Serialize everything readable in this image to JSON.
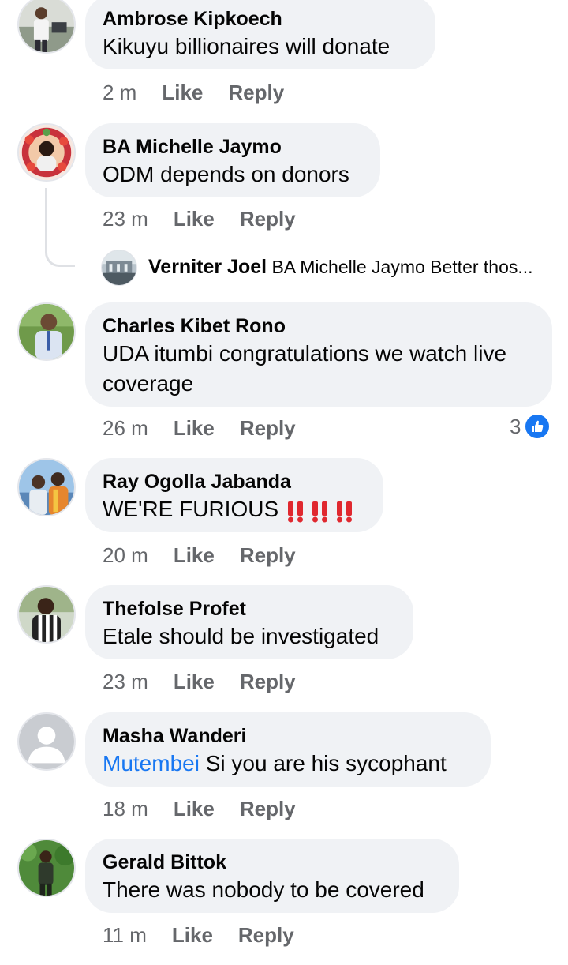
{
  "comments": [
    {
      "author": "Ambrose Kipkoech",
      "text": "Kikuyu billionaires will donate",
      "time": "2 m",
      "like": "Like",
      "reply": "Reply"
    },
    {
      "author": "BA Michelle Jaymo",
      "text": "ODM depends on donors",
      "time": "23 m",
      "like": "Like",
      "reply": "Reply",
      "reply_preview": {
        "author": "Verniter Joel",
        "text": "BA Michelle Jaymo Better thos..."
      }
    },
    {
      "author": "Charles Kibet Rono",
      "text_line1": "UDA itumbi congratulations we watch live",
      "text_line2": "coverage",
      "time": "26 m",
      "like": "Like",
      "reply": "Reply",
      "reaction_count": "3",
      "reaction_icon": "thumbs-up-icon"
    },
    {
      "author": "Ray Ogolla Jabanda",
      "text": "WE'RE FURIOUS",
      "emoji": "double-exclamation-icon x3",
      "time": "20 m",
      "like": "Like",
      "reply": "Reply"
    },
    {
      "author": "Thefolse Profet",
      "text": "Etale should be investigated",
      "time": "23 m",
      "like": "Like",
      "reply": "Reply"
    },
    {
      "author": "Masha Wanderi",
      "mention": "Mutembei",
      "text": " Si you are his sycophant",
      "time": "18 m",
      "like": "Like",
      "reply": "Reply"
    },
    {
      "author": "Gerald Bittok",
      "text": "There was nobody to be covered",
      "time": "11 m",
      "like": "Like",
      "reply": "Reply"
    }
  ],
  "colors": {
    "bubble": "#f0f2f5",
    "meta_text": "#65676b",
    "mention": "#1877f2",
    "like_badge": "#1877f2",
    "exclamation": "#e0282f"
  }
}
